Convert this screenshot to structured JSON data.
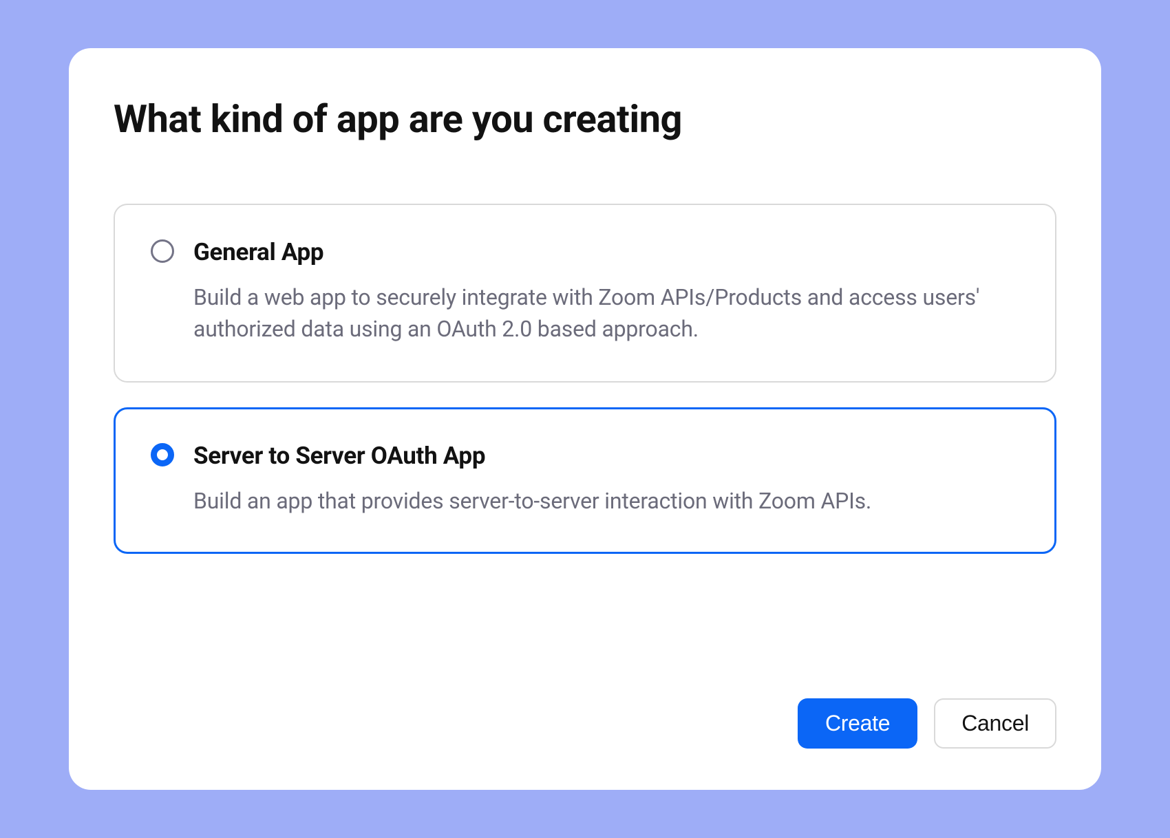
{
  "dialog": {
    "title": "What kind of app are you creating",
    "options": [
      {
        "title": "General App",
        "description": "Build a web app to securely integrate with Zoom APIs/Products and access users' authorized data using an OAuth 2.0 based approach.",
        "selected": false
      },
      {
        "title": "Server to Server OAuth App",
        "description": "Build an app that provides server-to-server interaction with Zoom APIs.",
        "selected": true
      }
    ],
    "buttons": {
      "create": "Create",
      "cancel": "Cancel"
    }
  }
}
